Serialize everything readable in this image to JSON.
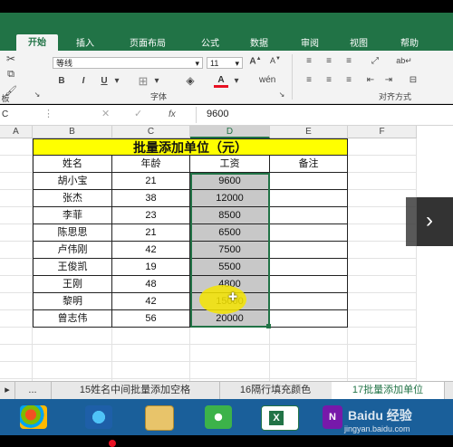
{
  "ribbon": {
    "tabs": [
      "开始",
      "插入",
      "页面布局",
      "公式",
      "数据",
      "审阅",
      "视图",
      "帮助"
    ],
    "font_name": "等线",
    "font_size": "11",
    "bold": "B",
    "italic": "I",
    "underline": "U",
    "grow_font": "A",
    "shrink_font": "A",
    "group_font": "字体",
    "group_alignment": "对齐方式",
    "font_color_icon": "A",
    "clipboard_left_label": "板"
  },
  "formula_bar": {
    "name_box": "C",
    "fx": "fx",
    "value": "9600"
  },
  "columns": [
    "A",
    "B",
    "C",
    "D",
    "E",
    "F"
  ],
  "table": {
    "title": "批量添加单位（元）",
    "headers": [
      "姓名",
      "年龄",
      "工资",
      "备注"
    ],
    "rows": [
      [
        "胡小宝",
        "21",
        "9600",
        ""
      ],
      [
        "张杰",
        "38",
        "12000",
        ""
      ],
      [
        "李菲",
        "23",
        "8500",
        ""
      ],
      [
        "陈思思",
        "21",
        "6500",
        ""
      ],
      [
        "卢伟刚",
        "42",
        "7500",
        ""
      ],
      [
        "王俊凯",
        "19",
        "5500",
        ""
      ],
      [
        "王刚",
        "48",
        "4800",
        ""
      ],
      [
        "黎明",
        "42",
        "15000",
        ""
      ],
      [
        "曾志伟",
        "56",
        "20000",
        ""
      ]
    ]
  },
  "sheet_tabs": {
    "nav_prev": "▸",
    "ellipsis": "...",
    "tabs": [
      "15姓名中间批量添加空格",
      "16隔行填充颜色",
      "17批量添加单位"
    ]
  },
  "watermark": "Baidu 经验",
  "watermark_url": "jingyan.baidu.com",
  "colors": {
    "excel_green": "#217346",
    "title_yellow": "#ffff00",
    "taskbar_blue": "#1a5f9a",
    "cursor_highlight": "#f5e400"
  }
}
